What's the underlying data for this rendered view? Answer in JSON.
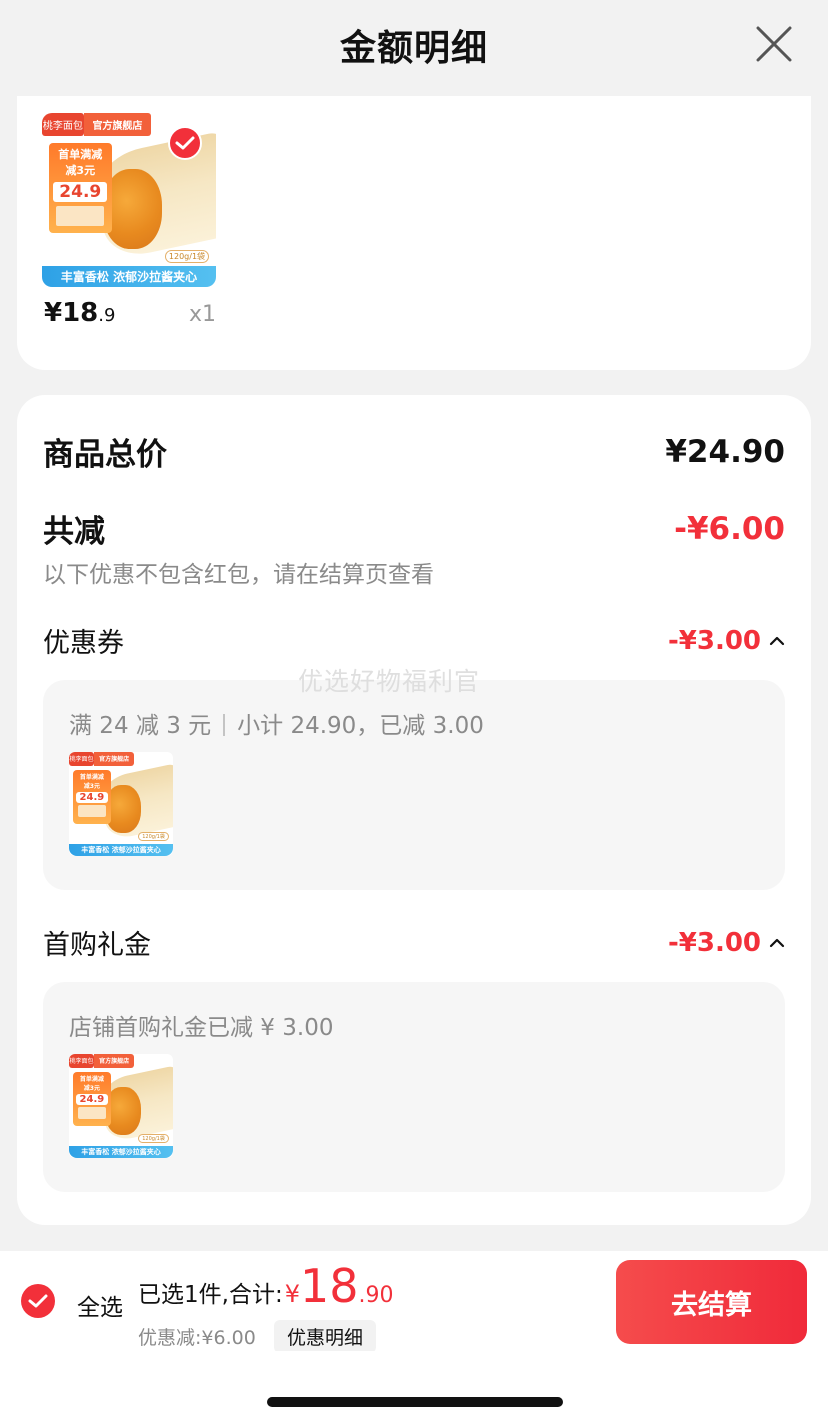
{
  "header": {
    "title": "金额明细",
    "close_icon": "close-icon"
  },
  "product": {
    "image": {
      "store_logo": "桃李面包",
      "store_badge": "官方旗舰店",
      "promo_line1": "首单满减",
      "promo_reduce": "减3元",
      "promo_price": "24.9",
      "band_text": "丰富香松 浓郁沙拉酱夹心",
      "weight_tag": "120g/1袋"
    },
    "price_int": "¥18",
    "price_dec": ".9",
    "quantity": "x1",
    "selected": true
  },
  "summary": {
    "total_label": "商品总价",
    "total_value": "¥24.90",
    "reduce_label": "共减",
    "reduce_value": "-¥6.00",
    "note": "以下优惠不包含红包，请在结算页查看",
    "coupon": {
      "label": "优惠券",
      "value": "-¥3.00",
      "detail_a": "满 24 减 3 元",
      "detail_b": "小计 24.90，已减 3.00"
    },
    "gift": {
      "label": "首购礼金",
      "value": "-¥3.00",
      "detail": "店铺首购礼金已减 ¥ 3.00"
    }
  },
  "watermark": "优选好物福利官",
  "bottom_bar": {
    "select_all_label": "全选",
    "selected_text": "已选1件,合计:",
    "total_yen": "¥",
    "total_int": "18",
    "total_dec": ".90",
    "discount_text": "优惠减:¥6.00",
    "detail_chip": "优惠明细",
    "checkout_label": "去结算"
  },
  "colors": {
    "accent_red": "#f2303a",
    "muted_text": "#8a8a8a",
    "panel_bg": "#f6f6f6"
  }
}
